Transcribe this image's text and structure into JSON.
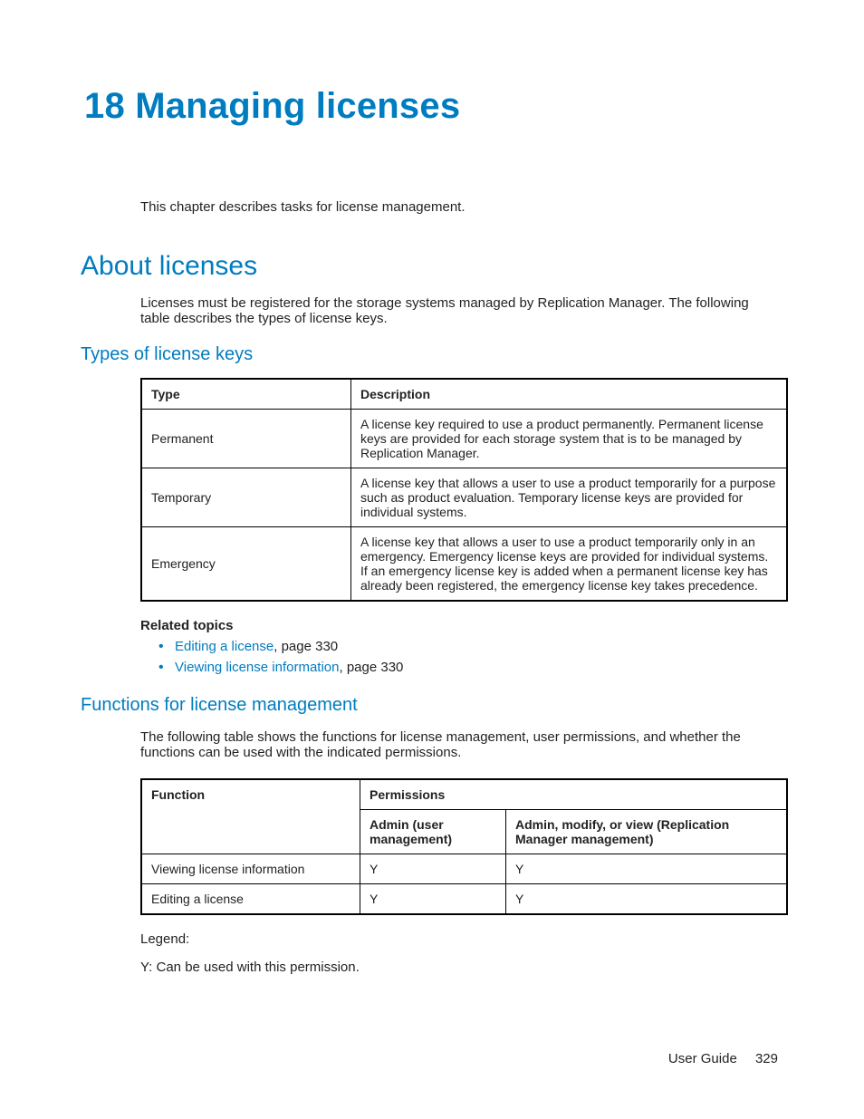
{
  "chapter": {
    "title": "18 Managing licenses",
    "intro": "This chapter describes tasks for license management."
  },
  "section_about": {
    "title": "About licenses",
    "body": "Licenses must be registered for the storage systems managed by Replication Manager. The following table describes the types of license keys."
  },
  "types_table": {
    "title": "Types of license keys",
    "headers": {
      "type": "Type",
      "description": "Description"
    },
    "rows": [
      {
        "type": "Permanent",
        "description": "A license key required to use a product permanently. Permanent license keys are provided for each storage system that is to be managed by Replication Manager."
      },
      {
        "type": "Temporary",
        "description": "A license key that allows a user to use a product temporarily for a purpose such as product evaluation. Temporary license keys are provided for individual systems."
      },
      {
        "type": "Emergency",
        "description": "A license key that allows a user to use a product temporarily only in an emergency. Emergency license keys are provided for individual systems. If an emergency license key is added when a permanent license key has already been registered, the emergency license key takes precedence."
      }
    ]
  },
  "related": {
    "heading": "Related topics",
    "items": [
      {
        "link": "Editing a license",
        "suffix": ", page 330"
      },
      {
        "link": "Viewing license information",
        "suffix": ", page 330"
      }
    ]
  },
  "functions": {
    "title": "Functions for license management",
    "body": "The following table shows the functions for license management, user permissions, and whether the functions can be used with the indicated permissions.",
    "headers": {
      "function": "Function",
      "permissions": "Permissions",
      "admin_user": "Admin (user management)",
      "admin_rep": "Admin, modify, or view (Replication Manager management)"
    },
    "rows": [
      {
        "function": "Viewing license information",
        "admin_user": "Y",
        "admin_rep": "Y"
      },
      {
        "function": "Editing a license",
        "admin_user": "Y",
        "admin_rep": "Y"
      }
    ]
  },
  "legend": {
    "label": "Legend:",
    "y": "Y: Can be used with this permission."
  },
  "footer": {
    "doc": "User Guide",
    "page": "329"
  }
}
